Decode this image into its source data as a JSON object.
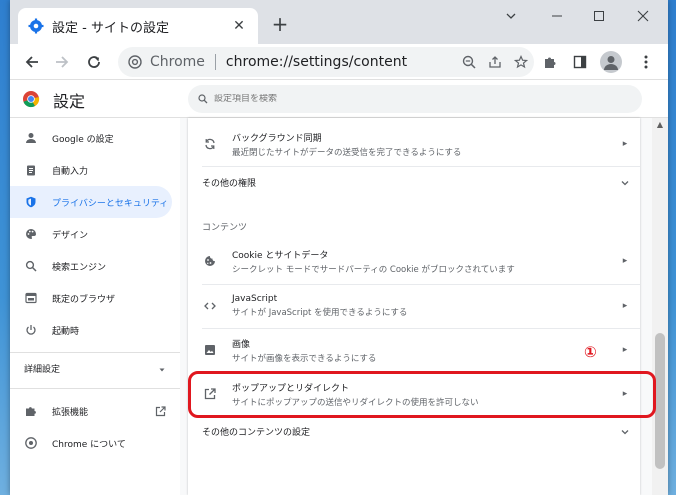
{
  "window": {
    "tab_title": "設定 - サイトの設定",
    "new_tab_label": "+"
  },
  "toolbar": {
    "site_label": "Chrome",
    "url": "chrome://settings/content"
  },
  "settings_header": {
    "title": "設定",
    "search_placeholder": "設定項目を検索"
  },
  "sidebar": {
    "items": [
      {
        "label": "Google の設定",
        "icon": "person-icon"
      },
      {
        "label": "自動入力",
        "icon": "clipboard-icon"
      },
      {
        "label": "プライバシーとセキュリティ",
        "icon": "shield-icon"
      },
      {
        "label": "デザイン",
        "icon": "palette-icon"
      },
      {
        "label": "検索エンジン",
        "icon": "search-icon"
      },
      {
        "label": "既定のブラウザ",
        "icon": "browser-icon"
      },
      {
        "label": "起動時",
        "icon": "power-icon"
      }
    ],
    "advanced_label": "詳細設定",
    "extensions_label": "拡張機能",
    "about_label": "Chrome について",
    "active_index": 2
  },
  "content": {
    "background_sync": {
      "title": "バックグラウンド同期",
      "desc": "最近閉じたサイトがデータの送受信を完了できるようにする"
    },
    "more_permissions_label": "その他の権限",
    "section_contents": "コンテンツ",
    "rows": [
      {
        "title": "Cookie とサイトデータ",
        "desc": "シークレット モードでサードパーティの Cookie がブロックされています"
      },
      {
        "title": "JavaScript",
        "desc": "サイトが JavaScript を使用できるようにする"
      },
      {
        "title": "画像",
        "desc": "サイトが画像を表示できるようにする"
      },
      {
        "title": "ポップアップとリダイレクト",
        "desc": "サイトにポップアップの送信やリダイレクトの使用を許可しない"
      }
    ],
    "more_content_label": "その他のコンテンツの設定"
  },
  "annotation": {
    "number": "①",
    "color": "#e0171f"
  },
  "colors": {
    "accent": "#1a73e8",
    "active_bg": "#e8f0fe",
    "tab_strip": "#dee1e6"
  }
}
